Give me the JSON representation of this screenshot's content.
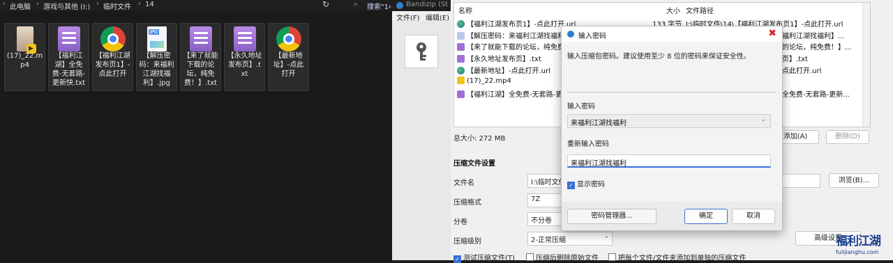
{
  "explorer": {
    "breadcrumb": [
      "此电脑",
      "游戏与其他 (I:)",
      "临时文件",
      "14"
    ],
    "search_placeholder": "搜索\"14\"",
    "files": [
      {
        "label": "(17)_22.mp4",
        "icon": "mp4-video-icon"
      },
      {
        "label": "【福利江湖】全免费-无套路-更新快.txt",
        "icon": "txt-file-icon"
      },
      {
        "label": "【福利江湖发布页1】-点此打开",
        "icon": "chrome-url-icon"
      },
      {
        "label": "【解压密码：来福利江湖找福利】.jpg",
        "icon": "jpg-file-icon"
      },
      {
        "label": "【来了就能下载的论坛，纯免费！】.txt",
        "icon": "txt-file-icon"
      },
      {
        "label": "【永久地址发布页】.txt",
        "icon": "txt-file-icon"
      },
      {
        "label": "【最新地址】-点此打开",
        "icon": "chrome-url-icon"
      }
    ]
  },
  "bandizip": {
    "title": "Bandizip (St",
    "menu": [
      "文件(F)",
      "编辑(E)"
    ],
    "list_headers": {
      "name": "名称",
      "size": "大小",
      "path": "文件路径"
    },
    "rows": [
      {
        "name": "【福利江湖发布页1】-点此打开.url",
        "size": "133 字节",
        "path": "I:\\临时文件\\14\\【福利江湖发布页1】-点此打开.url",
        "type": "url"
      },
      {
        "name": "【解压密码：来福利江湖找福利",
        "path": "福利江湖找福利】...",
        "type": "jpg"
      },
      {
        "name": "【来了就能下载的论坛，纯免费",
        "path": "的论坛，纯免费！】...",
        "type": "txt"
      },
      {
        "name": "【永久地址发布页】.txt",
        "path": "页】.txt",
        "type": "txt"
      },
      {
        "name": "【最新地址】-点此打开.url",
        "path": "点此打开.url",
        "type": "url"
      },
      {
        "name": "(17)_22.mp4",
        "path": "",
        "type": "mp4"
      },
      {
        "name": "【福利江湖】全免费-无套路-更新",
        "path": "全免费-无套路-更新...",
        "type": "txt"
      }
    ],
    "total_size": "总大小: 272 MB",
    "add_button": "添加(A)",
    "delete_button": "删除(D)",
    "section_title": "压缩文件设置",
    "filename_label": "文件名",
    "filename_value": "I:\\临时文件",
    "browse_button": "浏览(B)...",
    "format_label": "压缩格式",
    "format_value": "7Z",
    "split_label": "分卷",
    "split_value": "不分卷",
    "level_label": "压缩级别",
    "level_value": "2-正常压缩",
    "advanced_button": "高级设置",
    "check_test": "测试压缩文件(T)",
    "check_delete": "压缩后删除原始文件",
    "check_each": "把每个文件/文件夹添加到单独的压缩文件"
  },
  "dialog": {
    "title": "输入密码",
    "hint": "输入压缩包密码。建议使用至少 8 位的密码来保证安全性。",
    "label_password": "输入密码",
    "password_value": "来福利江湖找福利",
    "label_repeat": "重新输入密码",
    "repeat_value": "来福利江湖找福利",
    "show_password": "显示密码",
    "manager_button": "密码管理器...",
    "ok_button": "确定",
    "cancel_button": "取消"
  },
  "watermark": {
    "cn": "福利江湖",
    "en": "fulijianghu.com"
  }
}
